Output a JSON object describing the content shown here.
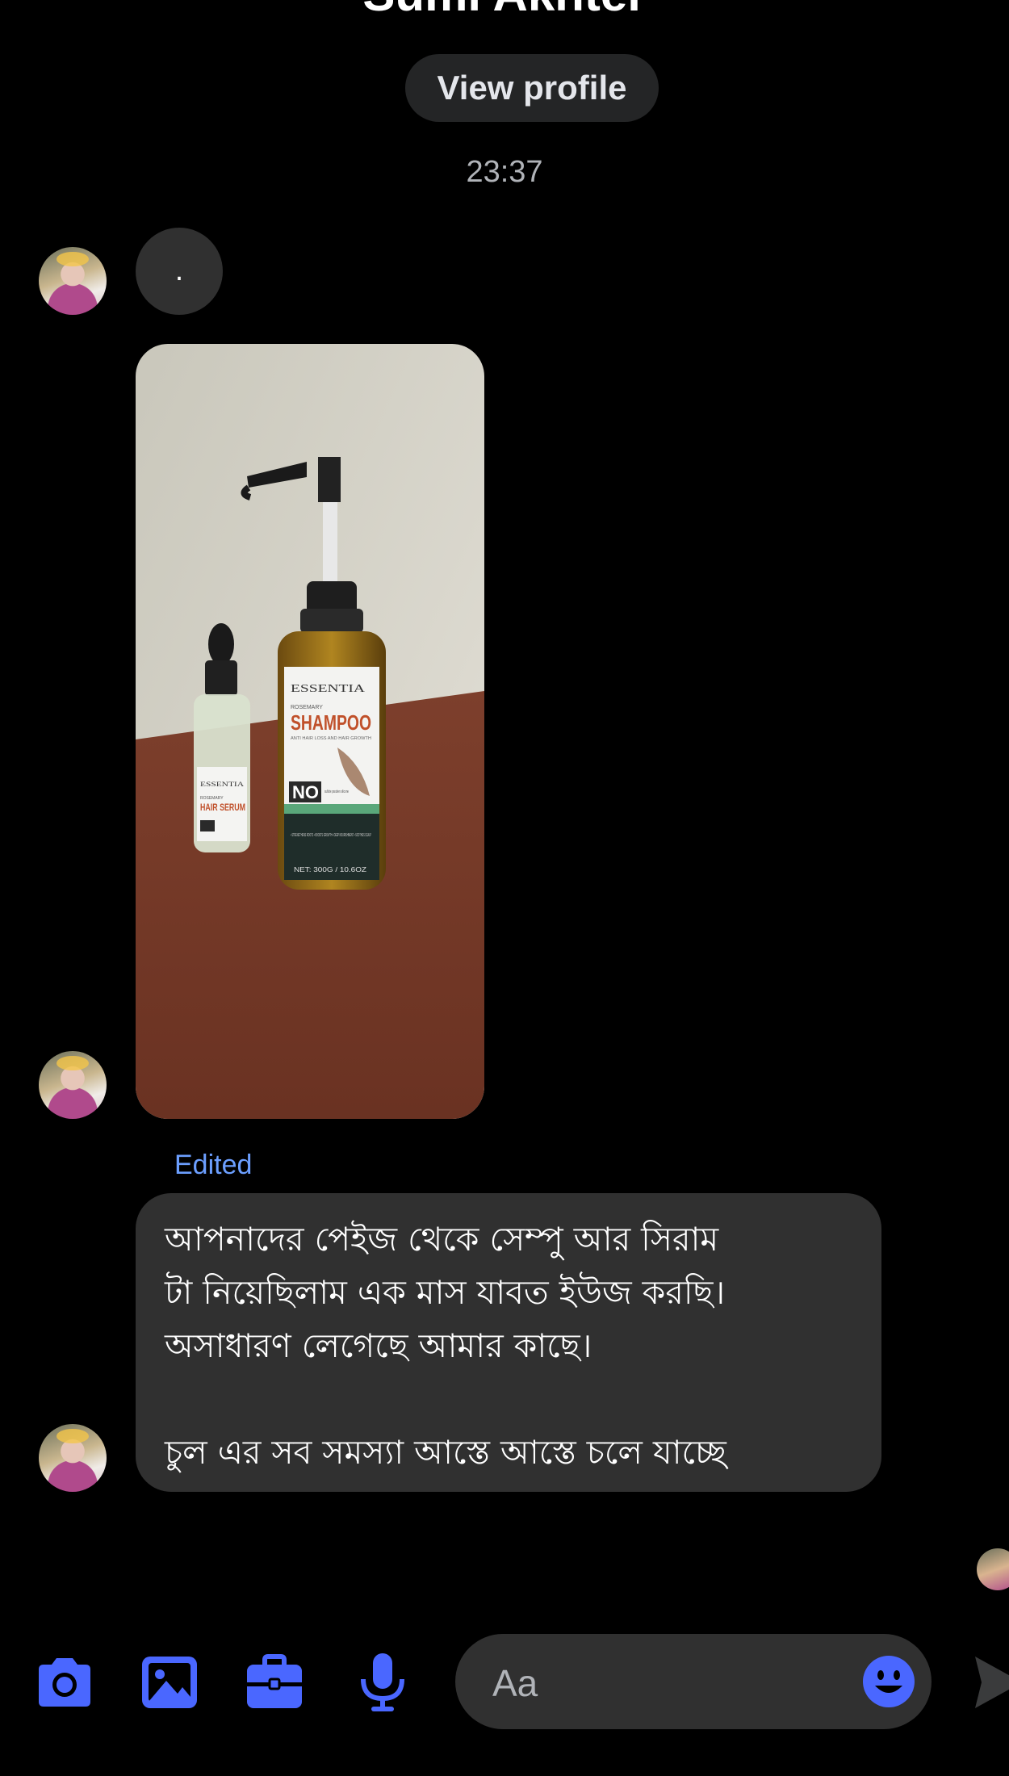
{
  "header": {
    "contact_name": "Sumi Akhter",
    "view_profile_label": "View profile"
  },
  "conversation": {
    "timestamp": "23:37",
    "dot_message": ".",
    "photo_subject": "Essentia Rosemary Shampoo and Hair Serum bottles",
    "product_labels": {
      "brand": "ESSENTIA",
      "shampoo_line": "ROSEMARY",
      "shampoo_name": "SHAMPOO",
      "shampoo_tagline": "ANTI HAIR LOSS AND HAIR GROWTH",
      "no_label": "NO",
      "no_list": "sulfate paraben silicone",
      "benefits": "• STRENGTHENS ROOTS • BOOSTS GROWTH • DEEP NOURISHMENT • SOOTHES SCALP",
      "net": "NET: 300G / 10.6OZ",
      "serum_line": "ROSEMARY",
      "serum_name": "HAIR SERUM"
    },
    "edited_label": "Edited",
    "message_lines": [
      "আপনাদের পেইজ থেকে সেম্পু আর সিরাম",
      "টা নিয়েছিলাম এক মাস যাবত ইউজ করছি।",
      "অসাধারণ লেগেছে আমার কাছে।",
      "",
      "চুল এর সব সমস্যা আস্তে আস্তে চলে যাচ্ছে"
    ]
  },
  "composer": {
    "placeholder": "Aa",
    "icons": [
      "camera-icon",
      "image-icon",
      "briefcase-icon",
      "microphone-icon",
      "emoji-icon",
      "send-icon"
    ],
    "accent_color": "#4a67ff"
  }
}
